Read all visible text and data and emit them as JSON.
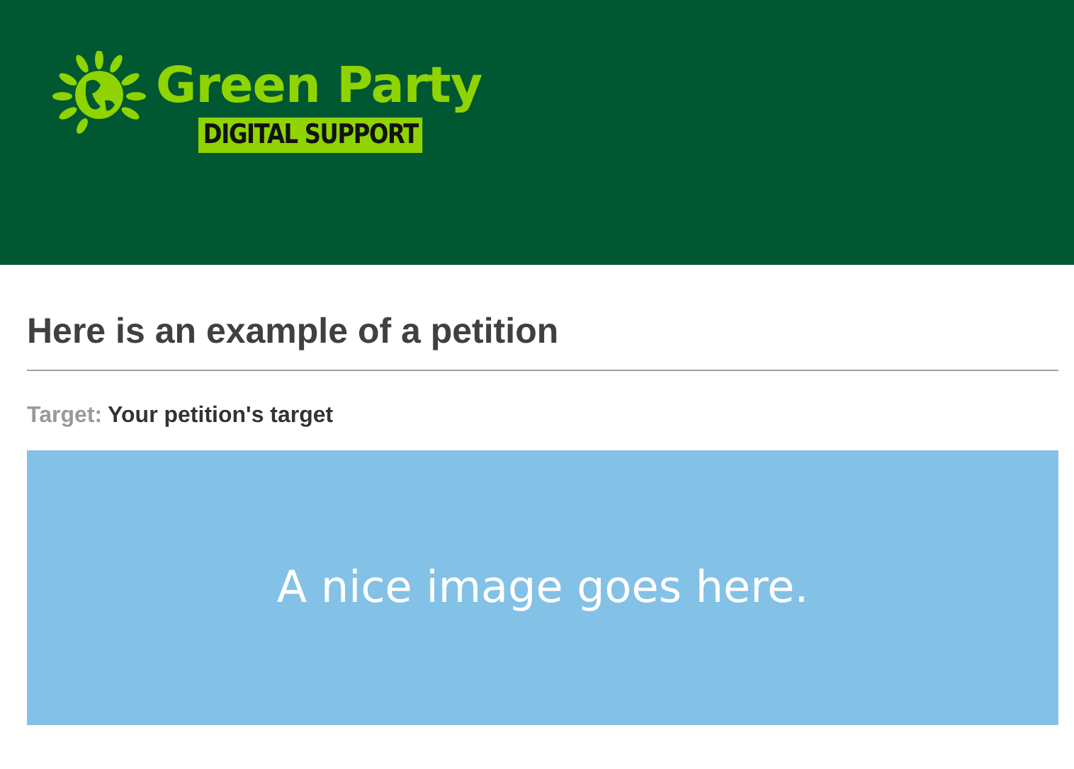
{
  "header": {
    "logo_name": "Green Party",
    "logo_tagline": "DIGITAL SUPPORT"
  },
  "petition": {
    "title": "Here is an example of a petition",
    "target_label": "Target:",
    "target_value": "Your petition's target",
    "image_text": "A nice image goes here."
  }
}
